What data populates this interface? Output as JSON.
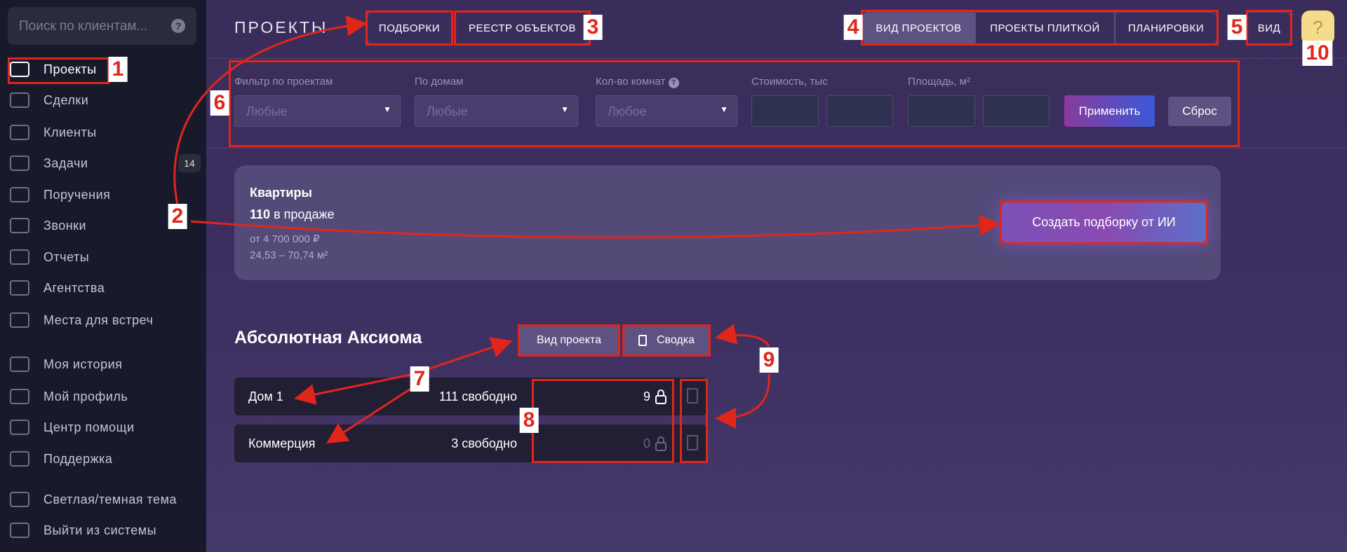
{
  "sidebar": {
    "search_placeholder": "Поиск по клиентам...",
    "items": [
      {
        "label": "Проекты",
        "icon": "projects-icon"
      },
      {
        "label": "Сделки",
        "icon": "deals-icon"
      },
      {
        "label": "Клиенты",
        "icon": "clients-icon"
      },
      {
        "label": "Задачи",
        "icon": "tasks-icon",
        "badge": "14"
      },
      {
        "label": "Поручения",
        "icon": "assignments-icon"
      },
      {
        "label": "Звонки",
        "icon": "calls-icon"
      },
      {
        "label": "Отчеты",
        "icon": "reports-icon"
      },
      {
        "label": "Агентства",
        "icon": "agencies-icon"
      },
      {
        "label": "Места для встреч",
        "icon": "meeting-places-icon"
      },
      {
        "label": "Моя история",
        "icon": "history-icon"
      },
      {
        "label": "Мой профиль",
        "icon": "profile-icon"
      },
      {
        "label": "Центр помощи",
        "icon": "help-center-icon"
      },
      {
        "label": "Поддержка",
        "icon": "support-icon"
      },
      {
        "label": "Светлая/темная тема",
        "icon": "theme-icon"
      },
      {
        "label": "Выйти из системы",
        "icon": "logout-icon"
      }
    ]
  },
  "header": {
    "title": "ПРОЕКТЫ",
    "tabs": [
      "ПОДБОРКИ",
      "РЕЕСТР ОБЪЕКТОВ"
    ],
    "view_tabs": [
      "ВИД ПРОЕКТОВ",
      "ПРОЕКТЫ ПЛИТКОЙ",
      "ПЛАНИРОВКИ"
    ],
    "view_button": "ВИД",
    "help": "?"
  },
  "filters": {
    "project_label": "Фильтр по проектам",
    "project_value": "Любые",
    "houses_label": "По домам",
    "houses_value": "Любые",
    "rooms_label": "Кол-во комнат",
    "rooms_value": "Любое",
    "cost_label": "Стоимость, тыс",
    "area_label": "Площадь, м²",
    "apply": "Применить",
    "reset": "Сброс"
  },
  "summary": {
    "title": "Квартиры",
    "count": "110",
    "count_suffix": "в продаже",
    "price": "от 4 700 000 ₽",
    "area": "24,53 – 70,74 м²",
    "ai_button": "Создать подборку от ИИ"
  },
  "project": {
    "name": "Абсолютная Аксиома",
    "view_button": "Вид проекта",
    "summary_button": "Сводка",
    "houses": [
      {
        "name": "Дом 1",
        "free": "111 свободно",
        "locked": "9"
      },
      {
        "name": "Коммерция",
        "free": "3 свободно",
        "locked": "0"
      }
    ]
  },
  "annotations": [
    "1",
    "2",
    "3",
    "4",
    "5",
    "6",
    "7",
    "8",
    "9",
    "10"
  ],
  "colors": {
    "annotation": "#e0261b",
    "apply_from": "#8a3a9a",
    "apply_to": "#3a5ad8"
  }
}
